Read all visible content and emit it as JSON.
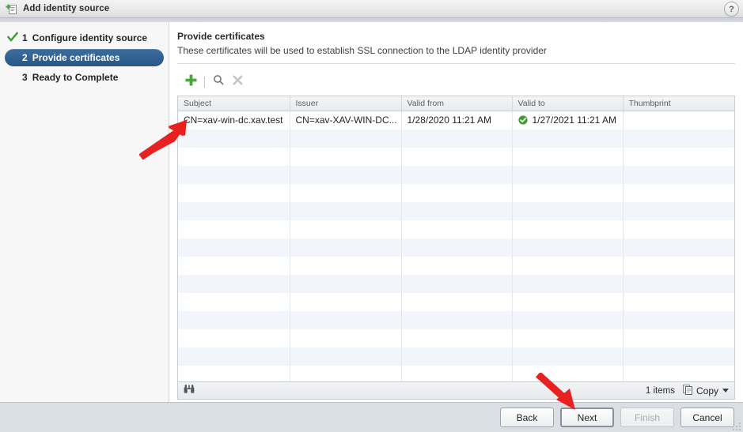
{
  "window": {
    "title": "Add identity source",
    "title_icon": "add-document-icon",
    "help_label": "?"
  },
  "sidebar": {
    "steps": [
      {
        "num": "1",
        "label": "Configure identity source",
        "state": "done"
      },
      {
        "num": "2",
        "label": "Provide certificates",
        "state": "active"
      },
      {
        "num": "3",
        "label": "Ready to Complete",
        "state": "pending"
      }
    ]
  },
  "content": {
    "title": "Provide certificates",
    "subtitle": "These certificates will be used to establish SSL connection to the LDAP identity provider",
    "toolbar": {
      "add_label": "+",
      "search_label": "search",
      "remove_label": "x"
    },
    "table": {
      "columns": [
        "Subject",
        "Issuer",
        "Valid from",
        "Valid to",
        "Thumbprint"
      ],
      "rows": [
        {
          "subject": "CN=xav-win-dc.xav.test",
          "issuer": "CN=xav-XAV-WIN-DC...",
          "valid_from": "1/28/2020 11:21 AM",
          "valid_to": "1/27/2021 11:21 AM",
          "valid_to_status": "ok",
          "thumbprint": ""
        }
      ],
      "empty_row_count": 14
    },
    "status": {
      "filter_icon": "binoculars-icon",
      "items_count": "1 items",
      "copy_label": "Copy"
    }
  },
  "footer": {
    "buttons": [
      {
        "label": "Back",
        "state": "enabled"
      },
      {
        "label": "Next",
        "state": "primary"
      },
      {
        "label": "Finish",
        "state": "disabled"
      },
      {
        "label": "Cancel",
        "state": "enabled"
      }
    ]
  },
  "annotations": {
    "arrows": [
      {
        "name": "arrow-to-certificate-row",
        "color": "#e8201f"
      },
      {
        "name": "arrow-to-next-button",
        "color": "#e8201f"
      }
    ]
  },
  "colors": {
    "accent_blue": "#2f5f8f",
    "success_green": "#3f9c35",
    "annotation_red": "#e8201f",
    "footer_bg": "#dadee5",
    "row_stripe": "#f2f5f9"
  }
}
